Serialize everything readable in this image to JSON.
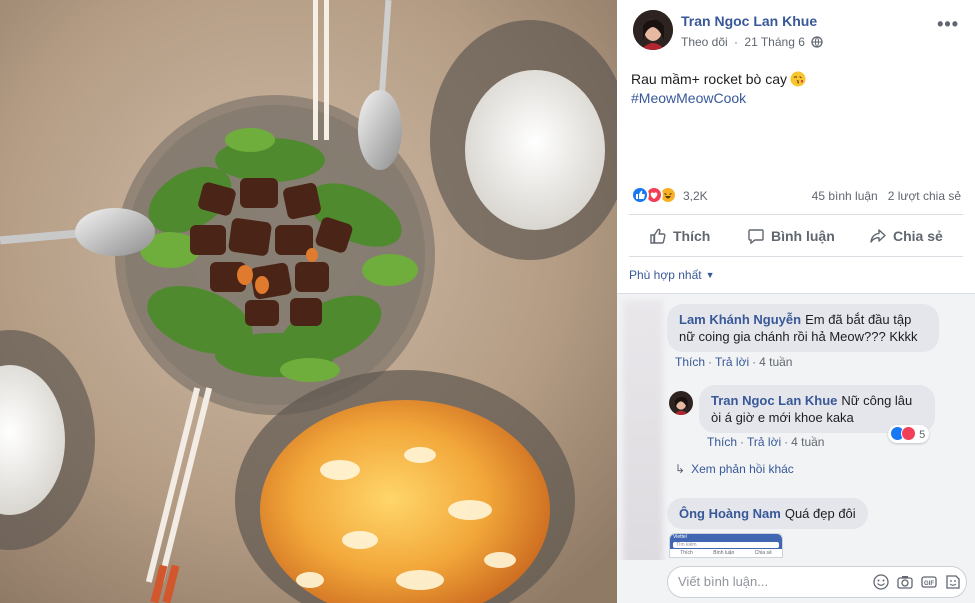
{
  "post": {
    "author": "Tran Ngoc Lan Khue",
    "follow_label": "Theo dõi",
    "separator": "·",
    "date": "21 Tháng 6",
    "more_label": "•••",
    "caption": "Rau mầm+ rocket bò cay",
    "hashtag": "#MeowMeowCook",
    "reaction_count": "3,2K",
    "comment_count": "45 bình luận",
    "share_count": "2 lượt chia sẻ",
    "actions": {
      "like": "Thích",
      "comment": "Bình luận",
      "share": "Chia sẻ"
    },
    "icons": {
      "globe": "globe-icon",
      "kiss": "kiss-emoji-icon",
      "like": "like-icon",
      "love": "love-icon",
      "haha": "haha-icon"
    },
    "colors": {
      "brand_blue": "#385898",
      "like_blue": "#1877f2",
      "love_red": "#f33e58",
      "haha_yellow": "#f7b125"
    }
  },
  "comments": {
    "sort_label": "Phù hợp nhất",
    "items": [
      {
        "author": "Lam Khánh Nguyễn",
        "text": "Em đã bắt đầu tập nữ coing gia chánh rồi hả Meow??? Kkkk",
        "like": "Thích",
        "reply": "Trả lời",
        "time": "4 tuần"
      },
      {
        "author": "Tran Ngoc Lan Khue",
        "text": "Nữ công lâu òi á giờ e mới khoe kaka",
        "like": "Thích",
        "reply": "Trả lời",
        "time": "4 tuần",
        "reaction_count": "5"
      },
      {
        "author": "Ông Hoàng Nam",
        "text": "Quá đẹp đôi"
      }
    ],
    "more_replies": "Xem phản hồi khác",
    "write_placeholder": "Viết bình luận...",
    "attachment": {
      "status": "Viettel",
      "search": "Tìm kiếm",
      "tab_like": "Thích",
      "tab_comment": "Bình luận",
      "tab_share": "Chia sẻ"
    }
  }
}
